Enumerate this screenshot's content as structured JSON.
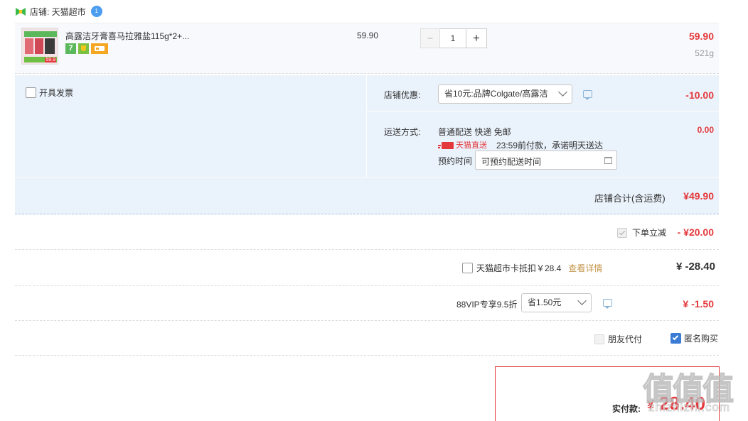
{
  "shop": {
    "label": "店铺: 天猫超市",
    "badge": "1"
  },
  "item": {
    "title": "高露洁牙膏喜马拉雅盐115g*2+...",
    "thumb_price": "59.9",
    "unit_price": "59.90",
    "quantity": "1",
    "minus": "−",
    "plus": "+",
    "subtotal": "59.90",
    "weight": "521g",
    "tag1": "7"
  },
  "invoice": {
    "label": "开具发票"
  },
  "promo": {
    "label": "店铺优惠:",
    "selected": "省10元:品牌Colgate/高露洁",
    "amount": "-10.00"
  },
  "delivery": {
    "label": "运送方式:",
    "method": "普通配送 快递 免邮",
    "brand": "天猫直送",
    "promise": "23:59前付款，承诺明天送达",
    "schedule_label": "预约时间",
    "schedule_placeholder": "可预约配送时间",
    "amount": "0.00"
  },
  "shop_total": {
    "label": "店铺合计(含运费)",
    "amount": "¥49.90"
  },
  "discount": {
    "label": "下单立减",
    "amount": "- ¥20.00"
  },
  "card": {
    "label": "天猫超市卡抵扣￥28.4",
    "link": "查看详情",
    "amount": "¥ -28.40"
  },
  "vip": {
    "label": "88VIP专享9.5折",
    "selected": "省1.50元",
    "amount": "¥ -1.50"
  },
  "options": {
    "friend_pay": "朋友代付",
    "anonymous": "匿名购买"
  },
  "summary": {
    "pay_label": "实付款:",
    "currency": "¥",
    "pay_amount": "28.40"
  },
  "watermark": {
    "text": "值值值",
    "url": "zhizhizhi.com"
  },
  "colors": {
    "accent_red": "#e4393c",
    "panel_blue": "#eaf2fb",
    "checkbox_blue": "#3a7bd5"
  }
}
